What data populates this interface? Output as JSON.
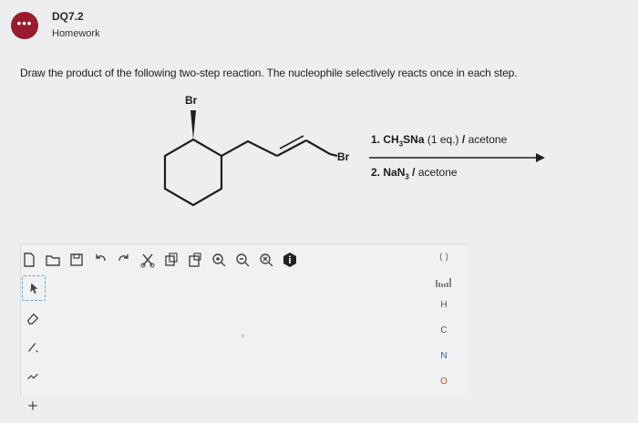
{
  "header": {
    "title": "DQ7.2",
    "subtitle": "Homework",
    "avatar_text": "•••",
    "accent": "#9a1a2e"
  },
  "question": {
    "prompt": "Draw the product of the following two-step reaction. The nucleophile selectively reacts once in each step."
  },
  "scheme": {
    "label_br_top": "Br",
    "label_br_end": "Br",
    "step1": {
      "number": "1.",
      "reagent_a": "CH",
      "sub_a": "3",
      "reagent_b": "SNa",
      "equiv": "(1 eq.)",
      "sep": "/",
      "solvent": "acetone"
    },
    "step2": {
      "number": "2.",
      "reagent_a": "NaN",
      "sub_a": "3",
      "sep": "/",
      "solvent": "acetone"
    }
  },
  "editor": {
    "toolbar": [
      "new-file-icon",
      "open-folder-icon",
      "save-icon",
      "undo-icon",
      "redo-icon",
      "cut-icon",
      "copy-icon",
      "paste-icon",
      "zoom-in-icon",
      "zoom-out-icon",
      "zoom-reset-icon",
      "info-icon"
    ],
    "elements": [
      "H",
      "C",
      "N",
      "O"
    ],
    "periodic_label": "⟨ ⟩"
  }
}
